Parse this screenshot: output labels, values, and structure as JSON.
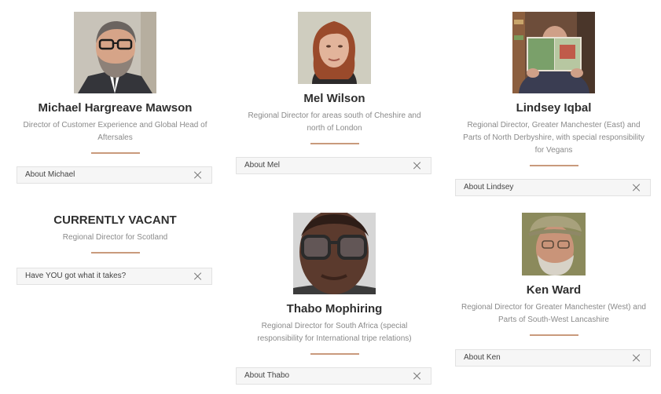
{
  "team": [
    {
      "name": "Michael Hargreave Mawson",
      "role": "Director of Customer Experience and Global Head of Aftersales",
      "toggle_label": "About Michael",
      "photo_colors": {
        "bg": "#c8c3b9",
        "skin": "#d6a488",
        "hair": "#6b6460",
        "jacket": "#34353a",
        "beard": "#8d8178"
      }
    },
    {
      "name": "Mel Wilson",
      "role": "Regional Director for areas south of Cheshire and north of London",
      "toggle_label": "About Mel",
      "photo_colors": {
        "bg": "#cfcdbf",
        "skin": "#e2b49b",
        "hair": "#9a4a2b",
        "jacket": "#2c2a2a"
      }
    },
    {
      "name": "Lindsey Iqbal",
      "role": "Regional Director, Greater Manchester (East) and Parts of North Derbyshire, with special responsibility for Vegans",
      "toggle_label": "About Lindsey",
      "photo_colors": {
        "bg": "#6d4d3a",
        "book": "#7aa06a",
        "jacket": "#3a3d52",
        "shelf": "#8c5f3f"
      }
    },
    {
      "name": "CURRENTLY VACANT",
      "role": "Regional Director for Scotland",
      "toggle_label": "Have YOU got what it takes?"
    },
    {
      "name": "Thabo Mophiring",
      "role": "Regional Director for South Africa (special responsibility for International tripe relations)",
      "toggle_label": "About Thabo",
      "photo_colors": {
        "bg": "#d6d6d6",
        "skin": "#5b3a2d",
        "glasses": "#2a2a2a"
      }
    },
    {
      "name": "Ken Ward",
      "role": "Regional Director for Greater Manchester (West) and Parts of South-West Lancashire",
      "toggle_label": "About Ken",
      "photo_colors": {
        "bg": "#8b8a5c",
        "skin": "#c99479",
        "cap": "#a8a17c",
        "beard": "#d7d2c7"
      }
    }
  ],
  "icons": {
    "toggle": "close-x-icon"
  },
  "accent_color": "#c99a7c"
}
